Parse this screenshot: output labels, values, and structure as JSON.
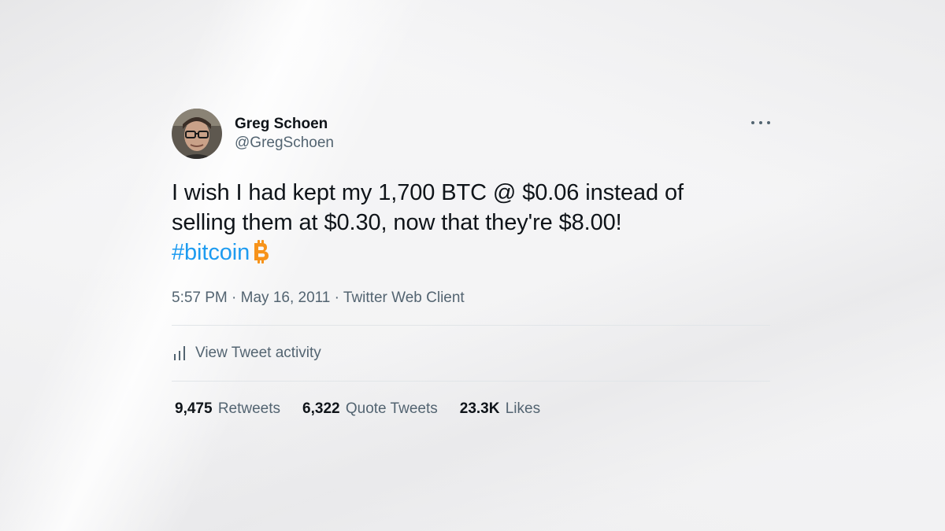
{
  "tweet": {
    "author": {
      "name": "Greg Schoen",
      "handle": "@GregSchoen"
    },
    "text_line1": "I wish I had kept my 1,700 BTC @ $0.06 instead of",
    "text_line2": "selling them at $0.30, now that they're $8.00!",
    "hashtag": "#bitcoin",
    "hashtag_icon": "bitcoin-icon",
    "meta": "5:57 PM · May 16, 2011 · Twitter Web Client",
    "activity_label": "View Tweet activity",
    "stats": [
      {
        "count": "9,475",
        "label": "Retweets"
      },
      {
        "count": "6,322",
        "label": "Quote Tweets"
      },
      {
        "count": "23.3K",
        "label": "Likes"
      }
    ]
  },
  "colors": {
    "text": "#0f1419",
    "secondary": "#536471",
    "link": "#1d9bf0",
    "bitcoin": "#f7931a"
  }
}
